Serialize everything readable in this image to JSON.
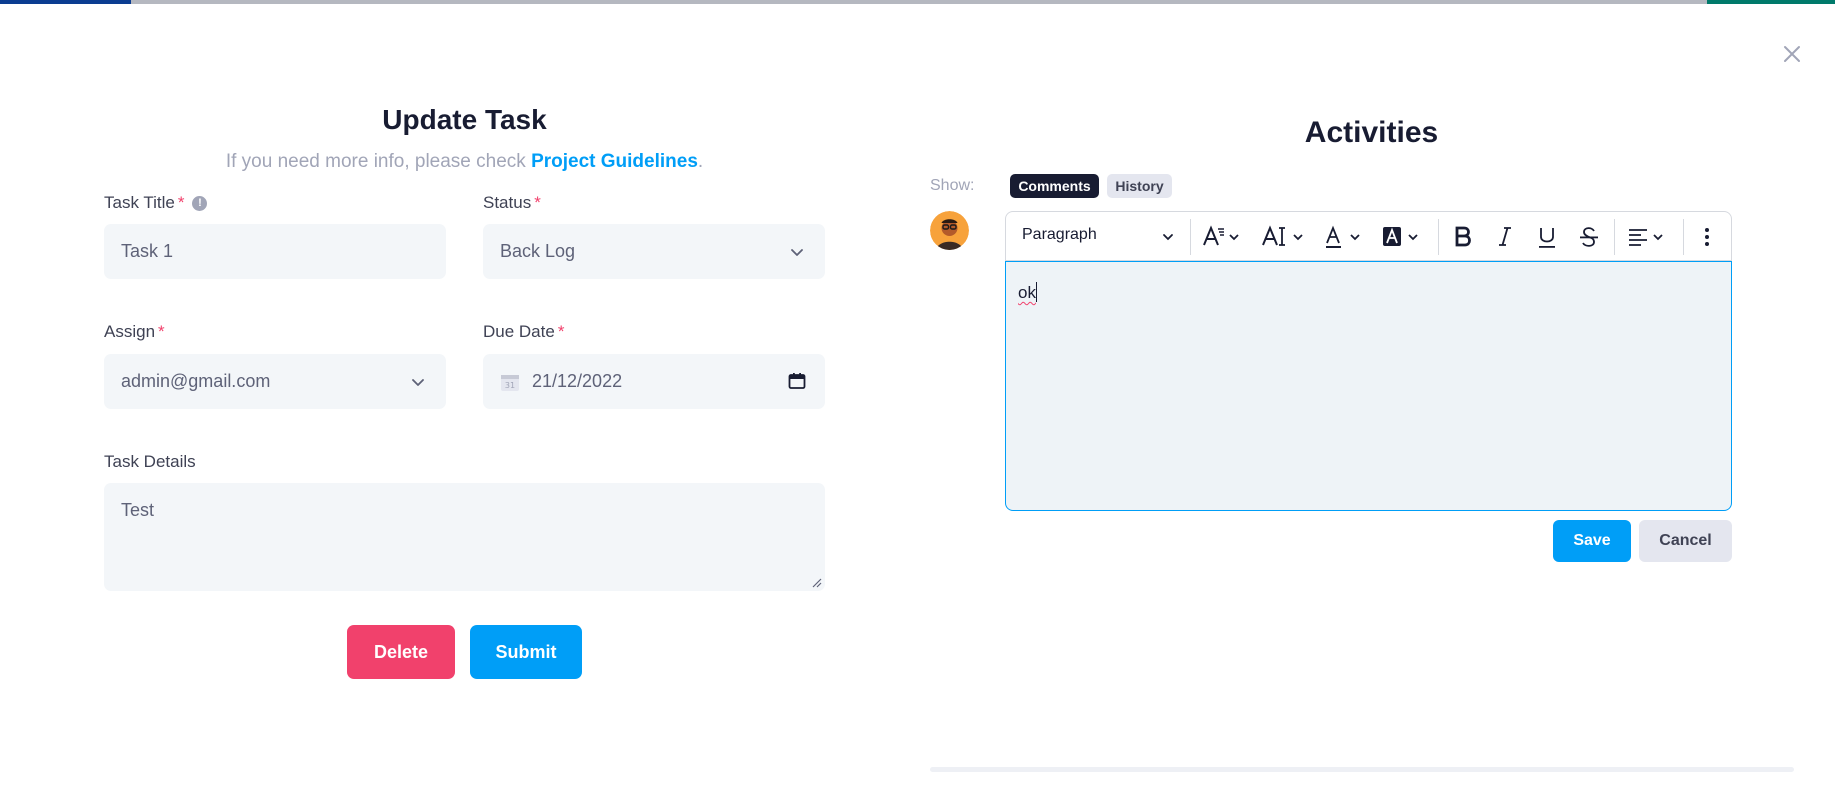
{
  "colors": {
    "primary": "#009ef7",
    "danger": "#f1416c",
    "dark": "#181c32",
    "muted": "#a1a5b7",
    "input_bg": "#f3f6f9"
  },
  "modal": {
    "close_icon": "close-icon"
  },
  "form": {
    "title": "Update Task",
    "subtitle_prefix": "If you need more info, please check ",
    "subtitle_link": "Project Guidelines",
    "subtitle_suffix": ".",
    "task_title": {
      "label": "Task Title",
      "required": "*",
      "value": "Task 1",
      "info_icon": "info-icon"
    },
    "status": {
      "label": "Status",
      "required": "*",
      "value": "Back Log"
    },
    "assign": {
      "label": "Assign",
      "required": "*",
      "value": "admin@gmail.com"
    },
    "due_date": {
      "label": "Due Date",
      "required": "*",
      "value": "21/12/2022"
    },
    "details": {
      "label": "Task Details",
      "value": "Test"
    },
    "delete_label": "Delete",
    "submit_label": "Submit"
  },
  "activities": {
    "title": "Activities",
    "show_label": "Show:",
    "tabs": [
      "Comments",
      "History"
    ],
    "active_tab": "Comments",
    "toolbar": {
      "block_style": "Paragraph",
      "icons": [
        "font-size-icon",
        "line-height-icon",
        "font-color-icon",
        "highlight-color-icon",
        "bold-icon",
        "italic-icon",
        "underline-icon",
        "strikethrough-icon",
        "align-left-icon",
        "more-vertical-icon"
      ]
    },
    "comment_text": "ok",
    "save_label": "Save",
    "cancel_label": "Cancel"
  }
}
